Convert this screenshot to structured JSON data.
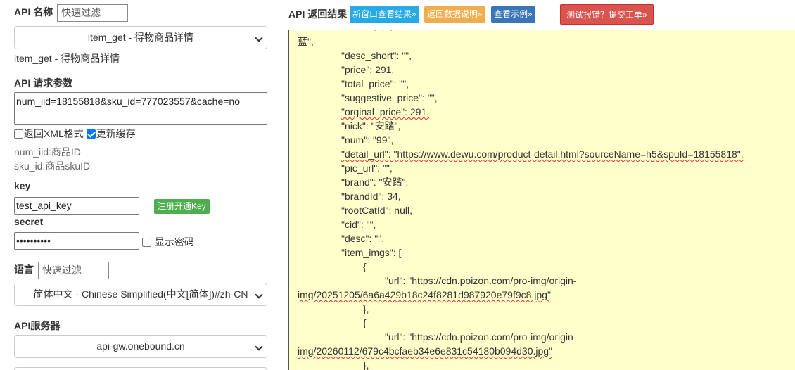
{
  "left": {
    "api_name_label": "API 名称",
    "api_filter_placeholder": "快速过滤",
    "api_selected": "item_get - 得物商品详情",
    "api_caption": "item_get - 得物商品详情",
    "params_label": "API 请求参数",
    "params_value": "num_iid=18155818&sku_id=777023557&cache=no",
    "checkbox_xml": "返回XML格式",
    "checkbox_xml_checked": false,
    "checkbox_cache": "更新缓存",
    "checkbox_cache_checked": true,
    "hint_1": "num_iid:商品ID",
    "hint_2": "sku_id:商品skuID",
    "key_label": "key",
    "key_value": "test_api_key",
    "register_button": "注册开通Key",
    "secret_label": "secret",
    "secret_value": "••••••••••",
    "show_password": "显示密码",
    "lang_label": "语言",
    "lang_filter_placeholder": "快速过滤",
    "lang_selected": "简体中文 - Chinese Simplified(中文[简体])#zh-CN",
    "server_label": "API服务器",
    "server_selected": "api-gw.onebound.cn"
  },
  "right": {
    "title": "API 返回结果",
    "btn_new_window": "新窗口查看结果»",
    "btn_doc": "返回数据说明»",
    "btn_example": "查看示例»",
    "btn_report": "测试报错？提交工单»",
    "lines": [
      "蓝\",",
      "\"desc_short\": \"\",",
      "\"price\": 291,",
      "\"total_price\": \"\",",
      "\"suggestive_price\": \"\",",
      "\"orginal_price\": 291,",
      "\"nick\": \"安踏\",",
      "\"num\": \"99\",",
      "\"detail_url\": \"https://www.dewu.com/product-detail.html?sourceName=h5&spuId=18155818\",",
      "\"pic_url\": \"\",",
      "\"brand\": \"安踏\",",
      "\"brandId\": 34,",
      "\"rootCatId\": null,",
      "\"cid\": \"\",",
      "\"desc\": \"\",",
      "\"item_imgs\": [",
      "{",
      "\"url\": \"https://cdn.poizon.com/pro-img/origin-",
      "img/20251205/6a6a429b18c24f8281d987920e79f9c8.jpg\"",
      "},",
      "{",
      "\"url\": \"https://cdn.poizon.com/pro-img/origin-",
      "img/20260112/679c4bcfaeb34e6e831c54180b094d30.jpg\"",
      "},"
    ]
  }
}
